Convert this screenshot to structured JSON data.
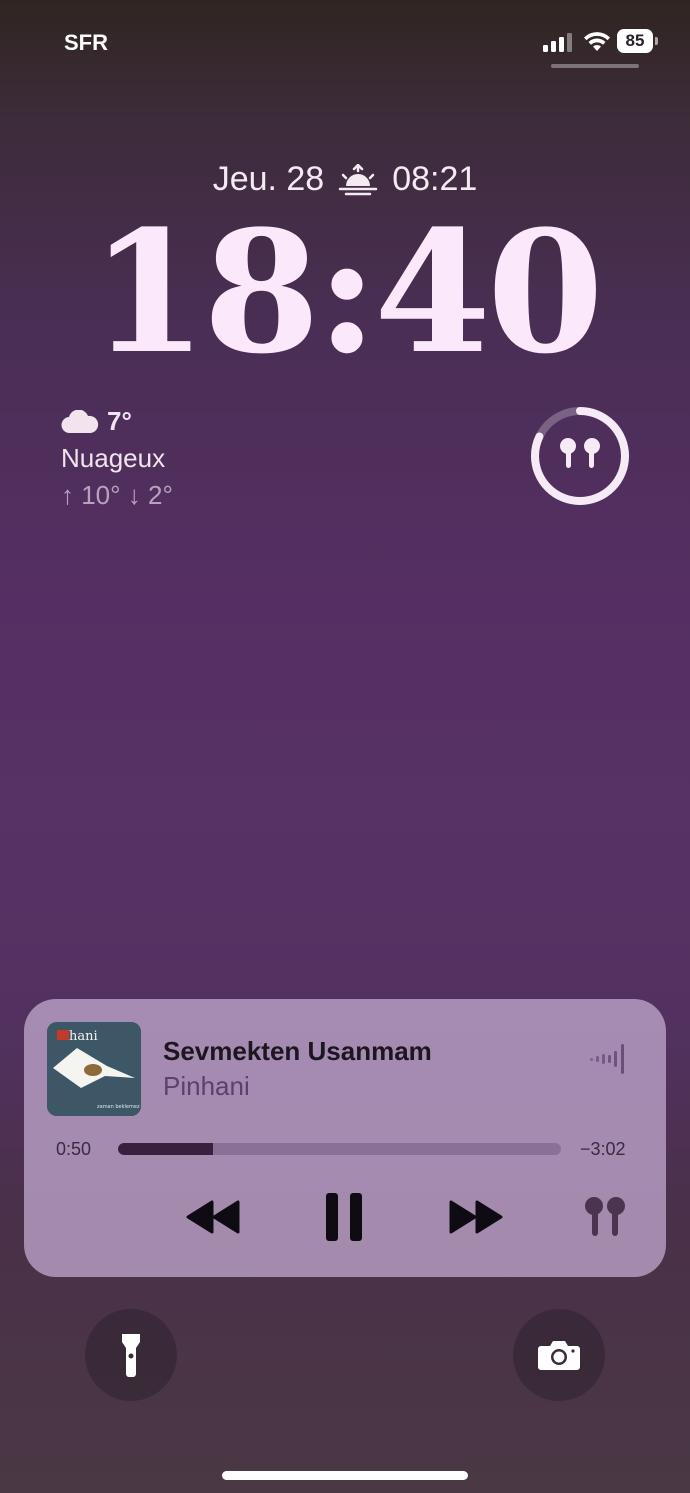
{
  "status_bar": {
    "carrier": "SFR",
    "battery_level": "85",
    "signal_icon": "cellular-signal-icon",
    "wifi_icon": "wifi-icon"
  },
  "date_line": {
    "date": "Jeu. 28",
    "sunrise_icon": "sunrise-icon",
    "sunrise_time": "08:21"
  },
  "clock": {
    "time": "18:40"
  },
  "weather": {
    "icon": "cloud-icon",
    "temperature": "7°",
    "condition": "Nuageux",
    "range": "↑ 10° ↓ 2°"
  },
  "airpods_widget": {
    "icon": "airpods-icon",
    "ring_fraction": 0.82
  },
  "now_playing": {
    "album_art_text": "hani",
    "album_art_subtitle": "zaman beklemez",
    "title": "Sevmekten Usanmam",
    "artist": "Pinhani",
    "elapsed": "0:50",
    "remaining": "−3:02",
    "progress": 0.215,
    "controls": {
      "rewind_icon": "rewind-icon",
      "pause_icon": "pause-icon",
      "forward_icon": "fast-forward-icon",
      "output_icon": "airpods-icon"
    }
  },
  "quick_actions": {
    "left": "flashlight-icon",
    "right": "camera-icon"
  },
  "colors": {
    "clock": "#fbe8fa",
    "card": "#b8a0c4",
    "accent_artist": "#5e3f6d"
  }
}
